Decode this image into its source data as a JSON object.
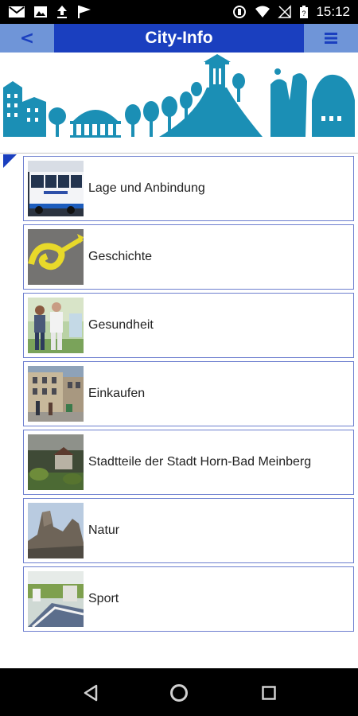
{
  "status_bar": {
    "time": "15:12",
    "icons": [
      "gmail-icon",
      "image-icon",
      "upload-icon",
      "flag-icon",
      "vibrate-icon",
      "wifi-icon",
      "no-signal-icon",
      "battery-icon"
    ]
  },
  "app_bar": {
    "back_label": "<",
    "title": "City-Info",
    "menu_icon": "hamburger-menu-icon"
  },
  "banner": {
    "description_icon": "city-skyline-banner",
    "color": "#1b8fb5"
  },
  "list": {
    "items": [
      {
        "label": "Lage und Anbindung",
        "thumb_icon": "bus-photo"
      },
      {
        "label": "Geschichte",
        "thumb_icon": "horn-photo"
      },
      {
        "label": "Gesundheit",
        "thumb_icon": "walkers-photo"
      },
      {
        "label": "Einkaufen",
        "thumb_icon": "shopping-street-photo"
      },
      {
        "label": "Stadtteile der Stadt Horn-Bad Meinberg",
        "thumb_icon": "village-photo"
      },
      {
        "label": "Natur",
        "thumb_icon": "rocks-photo"
      },
      {
        "label": "Sport",
        "thumb_icon": "sport-photo"
      }
    ]
  },
  "nav_bar": {
    "buttons": [
      "back-triangle-icon",
      "home-circle-icon",
      "recents-square-icon"
    ]
  },
  "colors": {
    "primary": "#1a3fbf",
    "button_bg": "#6f95d8",
    "border": "#6d7fcf"
  }
}
